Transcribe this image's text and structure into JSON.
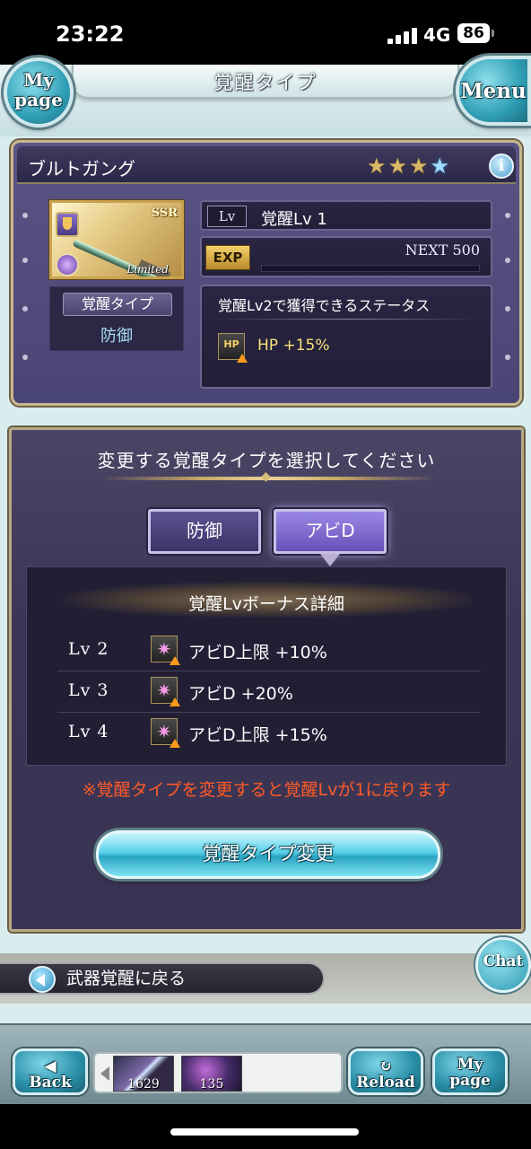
{
  "status_bar": {
    "time": "23:22",
    "network": "4G",
    "battery": "86"
  },
  "header": {
    "title": "覚醒タイプ",
    "mypage_label": "My page",
    "menu_label": "Menu"
  },
  "weapon": {
    "name": "ブルトガング",
    "rarity_label": "SSR",
    "limited_label": "Limited",
    "stars": [
      "★",
      "★",
      "★",
      "★"
    ],
    "info_label": "i",
    "awakening_type_label": "覚醒タイプ",
    "awakening_type_value": "防御",
    "lv_tag": "Lv",
    "lv_text": "覚醒Lv 1",
    "exp_tag": "EXP",
    "exp_next": "NEXT 500",
    "exp_progress": 0,
    "status_title": "覚醒Lv2で獲得できるステータス",
    "status_icon": "HP",
    "status_value": "HP +15%"
  },
  "selection": {
    "title": "変更する覚醒タイプを選択してください",
    "tabs": [
      {
        "label": "防御",
        "selected": false
      },
      {
        "label": "アビD",
        "selected": true
      }
    ],
    "bonus_title": "覚醒Lvボーナス詳細",
    "bonuses": [
      {
        "lv": "Lv 2",
        "icon": "sparkle-up-icon",
        "text": "アビD上限 +10%"
      },
      {
        "lv": "Lv 3",
        "icon": "sparkle-up-icon",
        "text": "アビD +20%"
      },
      {
        "lv": "Lv 4",
        "icon": "sparkle-up-icon",
        "text": "アビD上限 +15%"
      }
    ],
    "warning": "※覚醒タイプを変更すると覚醒Lvが1に戻ります",
    "change_button": "覚醒タイプ変更"
  },
  "back_link": {
    "label": "武器覚醒に戻る"
  },
  "chat_label": "Chat",
  "bottom_nav": {
    "back_label": "Back",
    "reload_label": "Reload",
    "mypage_label": "My page",
    "thumbs": [
      {
        "count": "1629"
      },
      {
        "count": "135"
      }
    ]
  },
  "colors": {
    "accent_cyan": "#59d0ea",
    "warning": "#ff5a25",
    "panel": "#4a4574",
    "gold_border": "#c6b88e"
  }
}
